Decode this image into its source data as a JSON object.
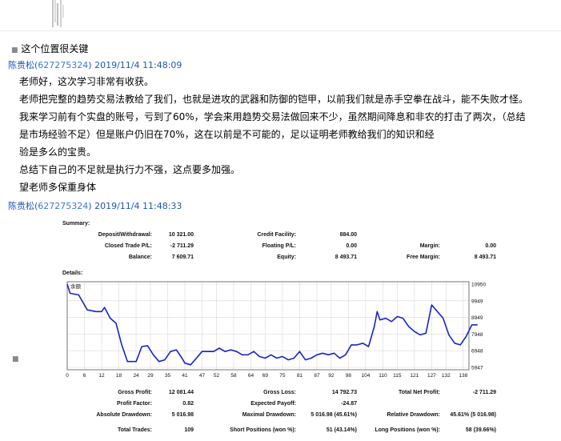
{
  "thread": {
    "prev_msg": "这个位置很关键",
    "msg1": {
      "sender_name": "陈贵松",
      "sender_qq": "627275324",
      "timestamp": "2019/11/4 11:48:09",
      "lines": [
        "老师好，这次学习非常有收获。",
        "老师把完整的趋势交易法教给了我们，也就是进攻的武器和防御的铠甲，以前我们就是赤手空拳在战斗，能不失败才怪。",
        "我来学习前有个实盘的账号，亏到了60%，学会来用趋势交易法做回来不少，虽然期间降息和非农的打击了两次，（总结",
        "是市场经验不足）但是账户仍旧在70%，这在以前是不可能的，足以证明老师教给我们的知识和经",
        "验是多么的宝贵。",
        "总结下自己的不足就是执行力不强，这点要多加强。",
        "望老师多保重身体"
      ]
    },
    "msg2": {
      "sender_name": "陈贵松",
      "sender_qq": "627275324",
      "timestamp": "2019/11/4 11:48:33"
    }
  },
  "report": {
    "summary_title": "Summary:",
    "details_title": "Details:",
    "summary": {
      "deposit_label": "Deposit/Withdrawal:",
      "deposit_value": "10 321.00",
      "credit_label": "Credit Facility:",
      "credit_value": "884.00",
      "closed_label": "Closed Trade P/L:",
      "closed_value": "-2 711.29",
      "floating_label": "Floating P/L:",
      "floating_value": "0.00",
      "margin_label": "Margin:",
      "margin_value": "0.00",
      "balance_label": "Balance:",
      "balance_value": "7 609.71",
      "equity_label": "Equity:",
      "equity_value": "8 493.71",
      "free_margin_label": "Free Margin:",
      "free_margin_value": "8 493.71"
    },
    "details": {
      "gross_profit_label": "Gross Profit:",
      "gross_profit_value": "12 081.44",
      "gross_loss_label": "Gross Loss:",
      "gross_loss_value": "14 792.73",
      "net_profit_label": "Total Net Profit:",
      "net_profit_value": "-2 711.29",
      "profit_factor_label": "Profit Factor:",
      "profit_factor_value": "0.82",
      "expected_payoff_label": "Expected Payoff:",
      "expected_payoff_value": "-24.87",
      "abs_dd_label": "Absolute Drawdown:",
      "abs_dd_value": "5 016.98",
      "max_dd_label": "Maximal Drawdown:",
      "max_dd_value": "5 016.98 (45.61%)",
      "rel_dd_label": "Relative Drawdown:",
      "rel_dd_value": "45.61% (5 016.98)",
      "total_trades_label": "Total Trades:",
      "total_trades_value": "109",
      "short_label": "Short Positions (won %):",
      "short_value": "51 (43.14%)",
      "long_label": "Long Positions (won %):",
      "long_value": "58 (39.66%)"
    }
  },
  "chart_data": {
    "type": "line",
    "legend": "余额",
    "x_ticks": [
      "0",
      "6",
      "12",
      "18",
      "24",
      "29",
      "35",
      "41",
      "47",
      "52",
      "58",
      "64",
      "69",
      "75",
      "81",
      "87",
      "92",
      "98",
      "104",
      "110",
      "115",
      "121",
      "127",
      "132",
      "138"
    ],
    "y_ticks": [
      "10950",
      "9949",
      "8949",
      "7948",
      "6948",
      "5947"
    ],
    "ylim": [
      5947,
      10950
    ],
    "xlim": [
      0,
      140
    ],
    "series": [
      {
        "values": [
          [
            0,
            10950
          ],
          [
            1,
            10400
          ],
          [
            4,
            10300
          ],
          [
            7,
            9400
          ],
          [
            10,
            9300
          ],
          [
            12,
            9300
          ],
          [
            13,
            9550
          ],
          [
            15,
            8900
          ],
          [
            17,
            8600
          ],
          [
            19,
            7300
          ],
          [
            21,
            6300
          ],
          [
            22,
            6300
          ],
          [
            24,
            6300
          ],
          [
            26,
            7200
          ],
          [
            28,
            7250
          ],
          [
            30,
            6700
          ],
          [
            32,
            6300
          ],
          [
            34,
            6400
          ],
          [
            36,
            6900
          ],
          [
            38,
            7000
          ],
          [
            40,
            6500
          ],
          [
            41,
            6200
          ],
          [
            43,
            6100
          ],
          [
            45,
            6500
          ],
          [
            47,
            6900
          ],
          [
            49,
            6900
          ],
          [
            51,
            6900
          ],
          [
            53,
            7100
          ],
          [
            55,
            6900
          ],
          [
            57,
            7000
          ],
          [
            59,
            6900
          ],
          [
            61,
            6700
          ],
          [
            63,
            6700
          ],
          [
            65,
            6900
          ],
          [
            67,
            6600
          ],
          [
            69,
            6500
          ],
          [
            71,
            6700
          ],
          [
            73,
            6500
          ],
          [
            75,
            6600
          ],
          [
            77,
            6400
          ],
          [
            79,
            6500
          ],
          [
            81,
            6900
          ],
          [
            83,
            6400
          ],
          [
            85,
            6500
          ],
          [
            87,
            6700
          ],
          [
            89,
            6800
          ],
          [
            91,
            6700
          ],
          [
            93,
            6800
          ],
          [
            95,
            6500
          ],
          [
            97,
            6700
          ],
          [
            99,
            7300
          ],
          [
            101,
            7300
          ],
          [
            103,
            7400
          ],
          [
            105,
            7200
          ],
          [
            107,
            8400
          ],
          [
            108,
            9300
          ],
          [
            109,
            8800
          ],
          [
            111,
            8900
          ],
          [
            113,
            8700
          ],
          [
            115,
            9000
          ],
          [
            117,
            8900
          ],
          [
            119,
            8400
          ],
          [
            121,
            8100
          ],
          [
            123,
            7900
          ],
          [
            125,
            8000
          ],
          [
            127,
            9700
          ],
          [
            129,
            9300
          ],
          [
            131,
            8900
          ],
          [
            133,
            7900
          ],
          [
            135,
            7400
          ],
          [
            137,
            7300
          ],
          [
            139,
            7800
          ],
          [
            141,
            8500
          ],
          [
            143,
            8500
          ]
        ]
      }
    ]
  }
}
